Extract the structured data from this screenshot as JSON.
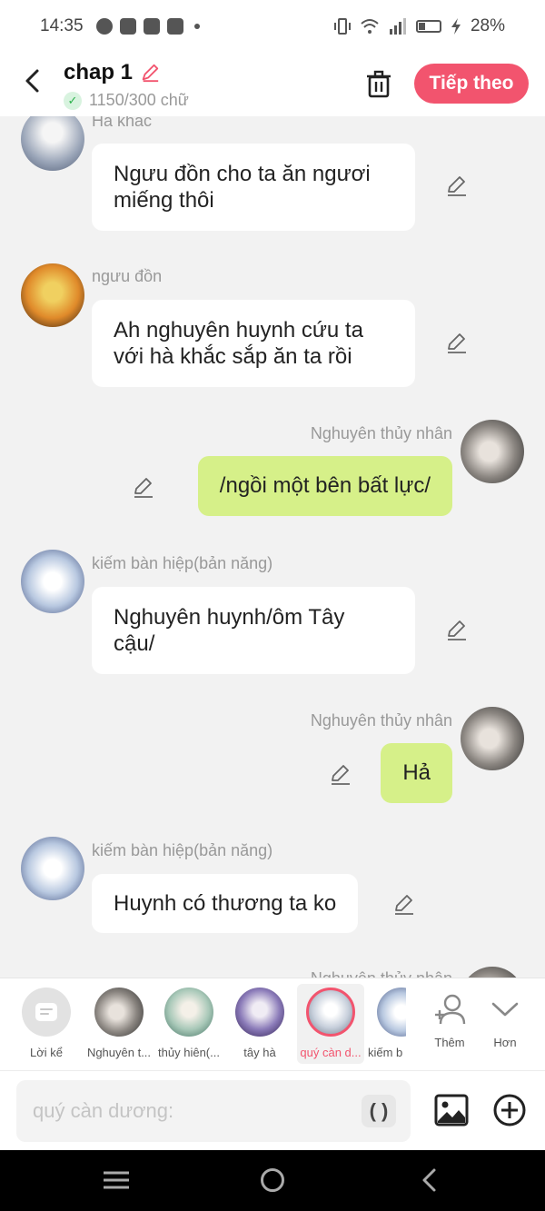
{
  "status_bar": {
    "time": "14:35",
    "battery": "28%"
  },
  "header": {
    "title": "chap 1",
    "word_count": "1150/300 chữ",
    "next_label": "Tiếp theo"
  },
  "messages": [
    {
      "speaker": "Hà khắc",
      "text_lines": [
        "Ngưu đồn cho ta ăn ngươi",
        "miếng thôi"
      ],
      "side": "left"
    },
    {
      "speaker": "ngưu đồn",
      "text_lines": [
        "Ah nghuyên huynh cứu ta",
        "với hà khắc sắp ăn ta rồi"
      ],
      "side": "left"
    },
    {
      "speaker": "Nghuyên thủy nhân",
      "text_lines": [
        "/ngồi một bên bất lực/"
      ],
      "side": "right"
    },
    {
      "speaker": "kiếm bàn hiệp(bản năng)",
      "text_lines": [
        "Nghuyên huynh/ôm Tây",
        "cậu/"
      ],
      "side": "left"
    },
    {
      "speaker": "Nghuyên thủy nhân",
      "text_lines": [
        "Hả"
      ],
      "side": "right"
    },
    {
      "speaker": "kiếm bàn hiệp(bản năng)",
      "text_lines": [
        "Huynh có thương ta ko"
      ],
      "side": "left"
    },
    {
      "speaker": "Nghuyên thủy nhân",
      "text_lines": [],
      "side": "right"
    }
  ],
  "characters": [
    {
      "label": "Lời kể",
      "type": "narration"
    },
    {
      "label": "Nghuyên t...",
      "color": "#6b6b6b"
    },
    {
      "label": "thủy hiên(...",
      "color": "#8fb8a8"
    },
    {
      "label": "tây hà",
      "color": "#5a4a8a"
    },
    {
      "label": "quý càn d...",
      "color": "#b8c8d8",
      "selected": true
    },
    {
      "label": "kiếm b",
      "color": "#c8d8e8"
    }
  ],
  "actions": {
    "add_label": "Thêm",
    "more_label": "Hơn"
  },
  "input": {
    "placeholder": "quý càn dương:",
    "paren_label": "( )"
  },
  "colors": {
    "accent": "#f2546e",
    "green_bubble": "#d6f089"
  }
}
